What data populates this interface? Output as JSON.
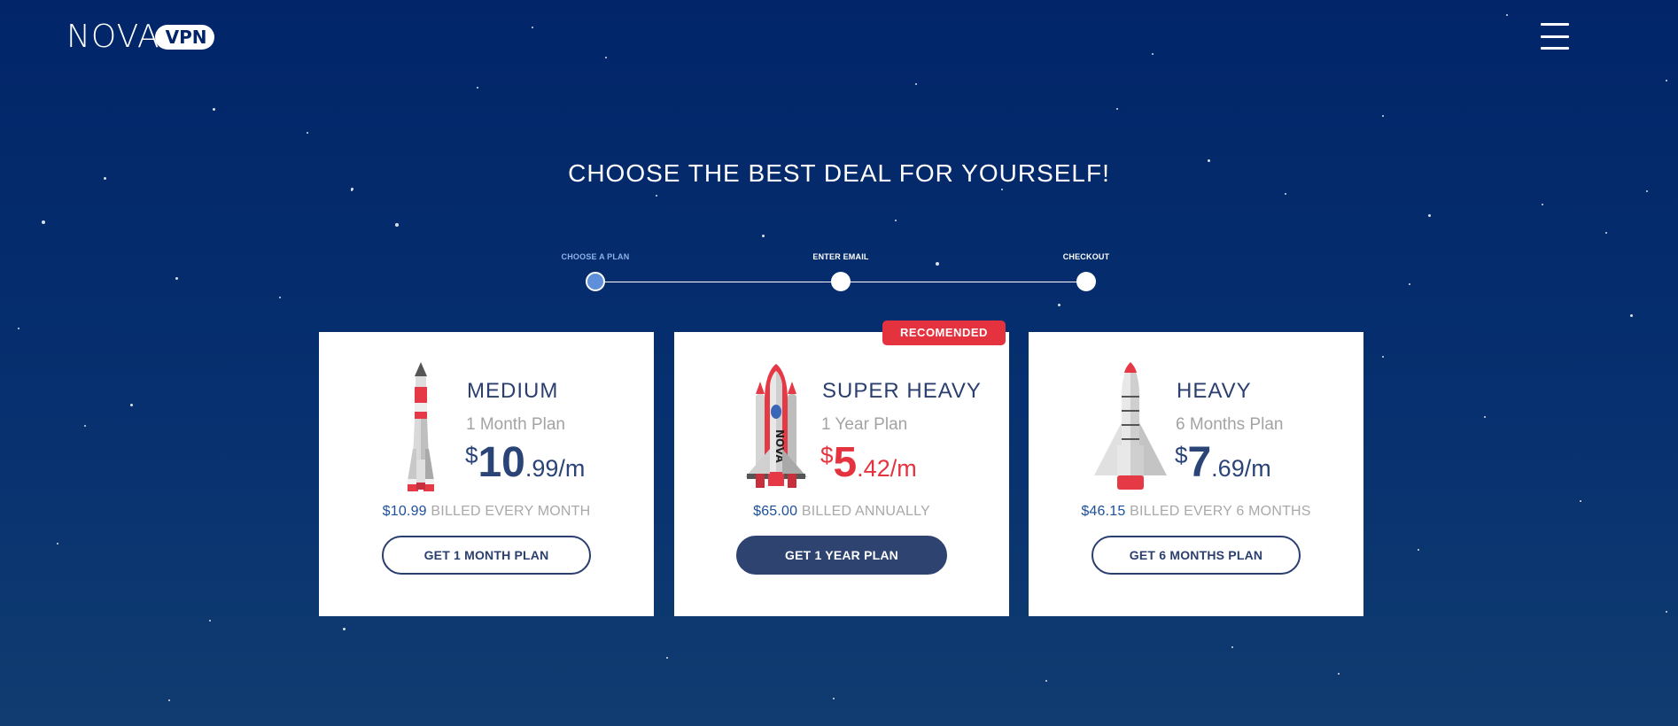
{
  "header": {
    "logo_text": "NOVA",
    "logo_badge": "VPN"
  },
  "headline": "CHOOSE THE BEST DEAL FOR YOURSELF!",
  "stepper": {
    "steps": [
      {
        "label": "CHOOSE A PLAN",
        "active": true
      },
      {
        "label": "ENTER EMAIL",
        "active": false
      },
      {
        "label": "CHECKOUT",
        "active": false
      }
    ]
  },
  "plans": [
    {
      "name": "MEDIUM",
      "subtitle": "1 Month Plan",
      "currency": "$",
      "price_int": "10",
      "price_dec": ".99/m",
      "billed_amount": "$10.99",
      "billed_text": "BILLED EVERY MONTH",
      "cta": "GET 1 MONTH PLAN",
      "icon": "rocket-icon"
    },
    {
      "name": "SUPER HEAVY",
      "subtitle": "1 Year Plan",
      "badge": "RECOMENDED",
      "currency": "$",
      "price_int": "5",
      "price_dec": ".42/m",
      "billed_amount": "$65.00",
      "billed_text": "BILLED ANNUALLY",
      "cta": "GET 1 YEAR PLAN",
      "icon": "space-shuttle-icon",
      "shuttle_text": "NOVA"
    },
    {
      "name": "HEAVY",
      "subtitle": "6 Months Plan",
      "currency": "$",
      "price_int": "7",
      "price_dec": ".69/m",
      "billed_amount": "$46.15",
      "billed_text": "BILLED EVERY 6 MONTHS",
      "cta": "GET 6 MONTHS PLAN",
      "icon": "heavy-rocket-icon"
    }
  ],
  "colors": {
    "background_top": "#022569",
    "background_bottom": "#103c71",
    "accent_red": "#e4333f",
    "navy": "#2b3f6e",
    "price_blue": "#2b4477",
    "muted_gray": "#a3a3a3"
  }
}
